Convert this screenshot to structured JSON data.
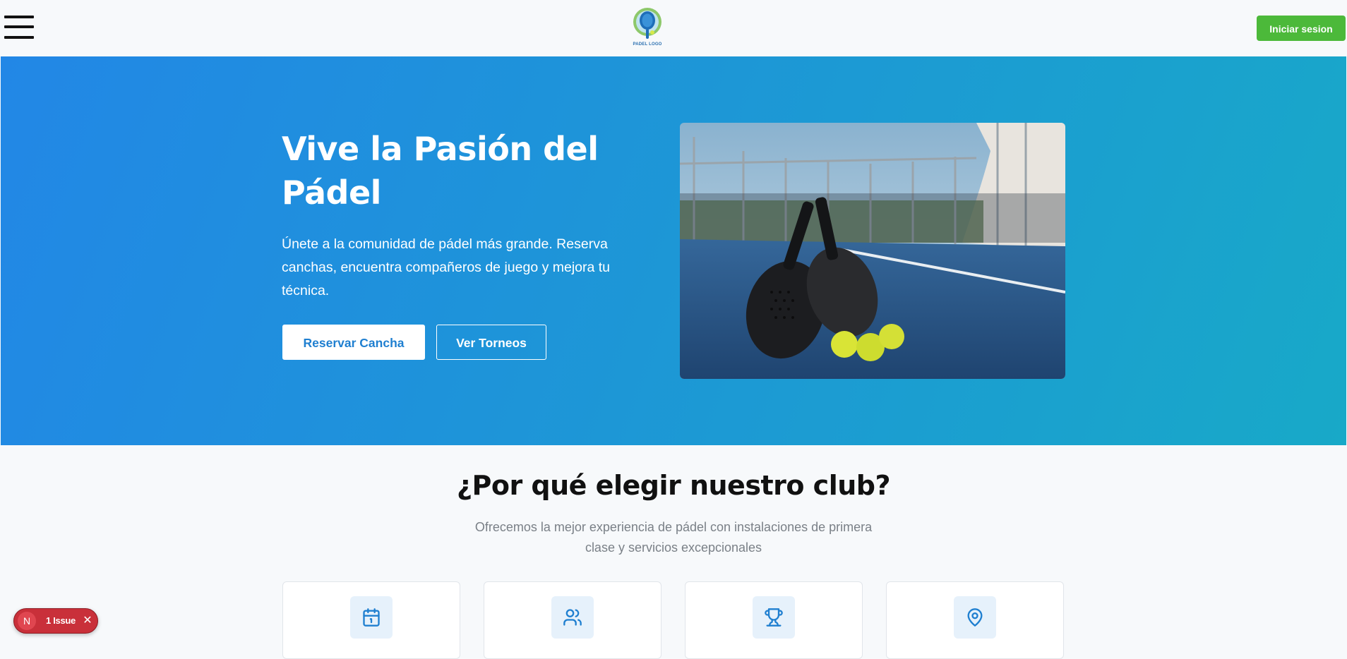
{
  "header": {
    "logo_text": "PADEL LOGO",
    "login_label": "Iniciar sesion"
  },
  "hero": {
    "title": "Vive la Pasión del Pádel",
    "description": "Únete a la comunidad de pádel más grande. Reserva canchas, encuentra compañeros de juego y mejora tu técnica.",
    "primary_button": "Reservar Cancha",
    "secondary_button": "Ver Torneos"
  },
  "features": {
    "title": "¿Por qué elegir nuestro club?",
    "subtitle": "Ofrecemos la mejor experiencia de pádel con instalaciones de primera clase y servicios excepcionales",
    "cards": [
      {
        "icon": "calendar-icon"
      },
      {
        "icon": "users-icon"
      },
      {
        "icon": "trophy-icon"
      },
      {
        "icon": "map-pin-icon"
      }
    ]
  },
  "issue_badge": {
    "logo_letter": "N",
    "label": "1 Issue",
    "close": "✕"
  },
  "colors": {
    "login_button": "#4cb93a",
    "hero_gradient_start": "#2287e6",
    "hero_gradient_end": "#18a9c8",
    "accent": "#1f7fd0",
    "issue_badge": "#c9303a"
  }
}
